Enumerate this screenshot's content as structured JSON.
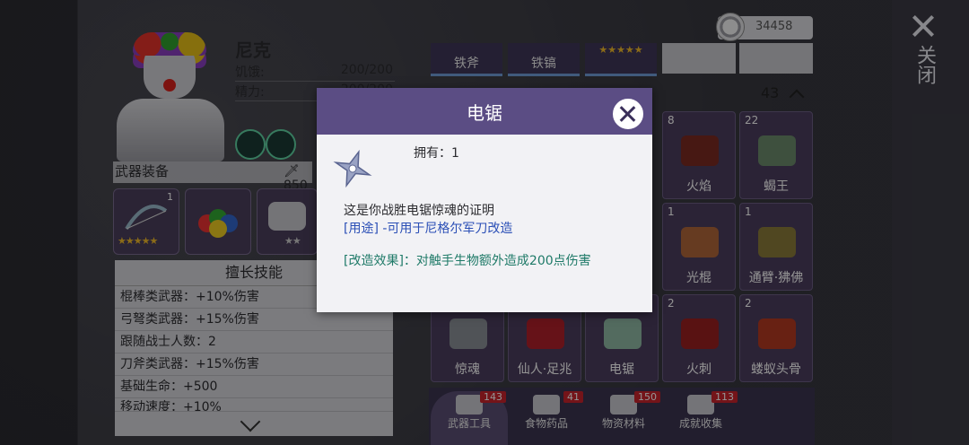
{
  "coins": {
    "amount": "34458"
  },
  "rail": {
    "close_label": "关闭"
  },
  "character": {
    "name": "尼克",
    "stats": [
      {
        "label": "饥饿:",
        "value": "200/200"
      },
      {
        "label": "精力:",
        "value": "200/200"
      }
    ]
  },
  "weapons": {
    "title": "武器装备",
    "power": "850",
    "slot1_count": "1",
    "slot1_stars": "★★★★★",
    "slot3_stars": "★★"
  },
  "skills": {
    "title": "擅长技能",
    "items": [
      "棍棒类武器：+10%伤害",
      "弓弩类武器：+15%伤害",
      "跟随战士人数：2",
      "刀斧类武器：+15%伤害",
      "基础生命：+500",
      "移动速度：+10%"
    ]
  },
  "inventory": {
    "tabs": [
      "铁斧",
      "铁镐"
    ],
    "tab3_stars": "★★★★★",
    "count": "43",
    "items": [
      {
        "num": "8",
        "name": "火焰"
      },
      {
        "num": "22",
        "name": "蝎王"
      },
      {
        "num": "1",
        "name": "光棍"
      },
      {
        "num": "1",
        "name": "通臂·狒佛"
      },
      {
        "num": "",
        "name": "惊魂"
      },
      {
        "num": "",
        "name": "仙人·足兆"
      },
      {
        "num": "",
        "name": "电锯"
      },
      {
        "num": "2",
        "name": "火刺"
      },
      {
        "num": "2",
        "name": "蝼蚁头骨"
      }
    ]
  },
  "bottom_tabs": [
    {
      "label": "武器工具",
      "badge": "143"
    },
    {
      "label": "食物药品",
      "badge": "41"
    },
    {
      "label": "物资材料",
      "badge": "150"
    },
    {
      "label": "成就收集",
      "badge": "113"
    }
  ],
  "dialog": {
    "title": "电锯",
    "owned": "拥有：1",
    "description": "这是你战胜电锯惊魂的证明",
    "usage": "[用途] -可用于尼格尔军刀改造",
    "effect": "[改造效果]：对触手生物额外造成200点伤害"
  }
}
